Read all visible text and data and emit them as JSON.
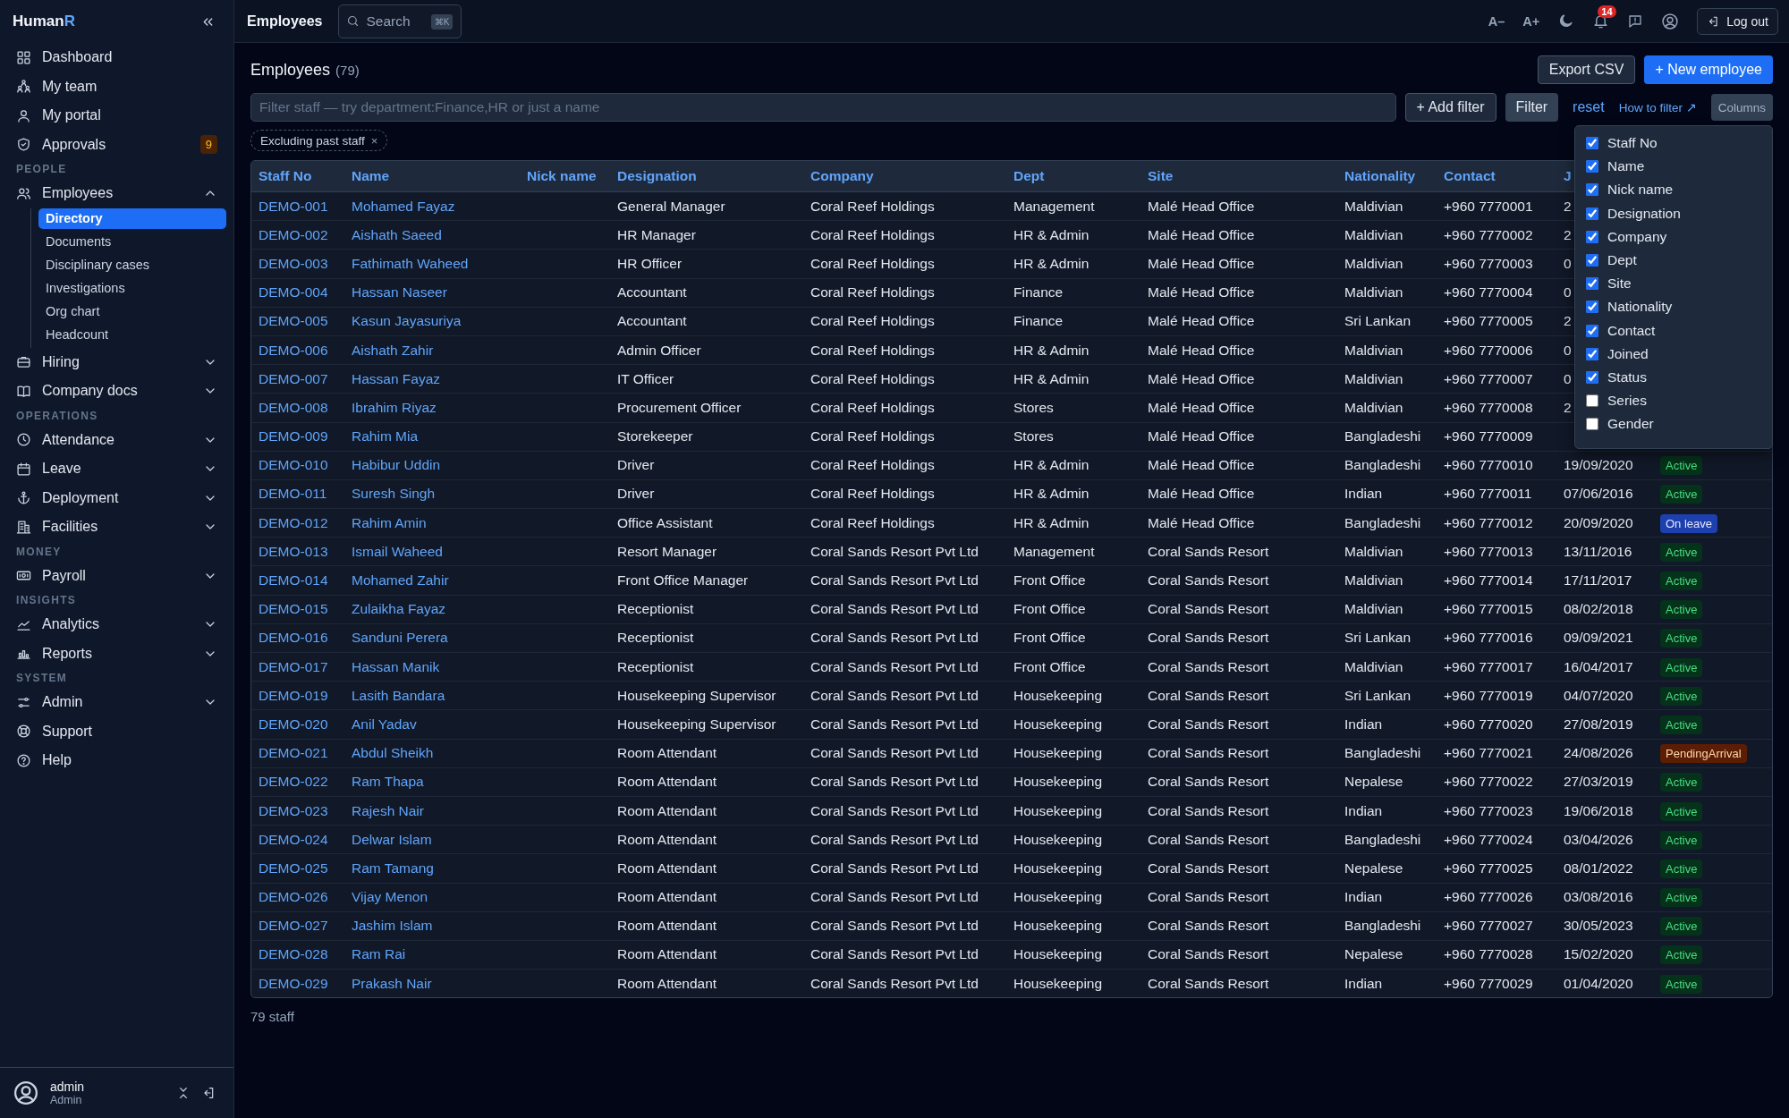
{
  "sidebar": {
    "brand": {
      "name": "Human",
      "accent": "R"
    },
    "groups": [
      {
        "items": [
          {
            "label": "Dashboard",
            "selected": false
          },
          {
            "label": "My team",
            "selected": false
          },
          {
            "label": "My portal",
            "selected": false
          },
          {
            "label": "Approvals",
            "badge": "9",
            "selected": false
          }
        ]
      },
      {
        "heading": "PEOPLE",
        "items": [
          {
            "label": "Employees",
            "selected": false,
            "expanded": true,
            "children": [
              {
                "label": "Directory",
                "selected": true
              },
              {
                "label": "Documents",
                "selected": false
              },
              {
                "label": "Disciplinary cases",
                "selected": false
              },
              {
                "label": "Investigations",
                "selected": false
              },
              {
                "label": "Org chart",
                "selected": false
              },
              {
                "label": "Headcount",
                "selected": false
              }
            ]
          },
          {
            "label": "Hiring",
            "selected": false,
            "expanded": false
          },
          {
            "label": "Company docs",
            "selected": false,
            "expanded": false
          }
        ]
      },
      {
        "heading": "OPERATIONS",
        "items": [
          {
            "label": "Attendance",
            "selected": false,
            "expanded": false
          },
          {
            "label": "Leave",
            "selected": false,
            "expanded": false
          },
          {
            "label": "Deployment",
            "selected": false,
            "expanded": false
          },
          {
            "label": "Facilities",
            "selected": false,
            "expanded": false
          }
        ]
      },
      {
        "heading": "MONEY",
        "items": [
          {
            "label": "Payroll",
            "selected": false,
            "expanded": false
          }
        ]
      },
      {
        "heading": "INSIGHTS",
        "items": [
          {
            "label": "Analytics",
            "selected": false,
            "expanded": false
          },
          {
            "label": "Reports",
            "selected": false,
            "expanded": false
          }
        ]
      },
      {
        "heading": "SYSTEM",
        "items": [
          {
            "label": "Admin",
            "selected": false,
            "expanded": false
          },
          {
            "label": "Support",
            "selected": false
          },
          {
            "label": "Help",
            "selected": false
          }
        ]
      }
    ],
    "user": {
      "name": "admin",
      "role": "Admin"
    }
  },
  "topbar": {
    "title": "Employees",
    "search": {
      "placeholder": "Search",
      "shortcut": "⌘K"
    },
    "font_smaller": "A–",
    "font_larger": "A+",
    "notifications": "14",
    "logout": "Log out"
  },
  "page": {
    "title": "Employees",
    "count": "(79)",
    "export": "Export CSV",
    "new_employee": "+ New employee",
    "filter": {
      "placeholder": "Filter staff — try department:Finance,HR or just a name"
    },
    "add_filter": "+ Add filter",
    "filter_button": "Filter",
    "reset": "reset",
    "help_link": "How to filter ↗",
    "columns_button": "Columns",
    "chips": [
      {
        "label": "Excluding past staff",
        "remove": "×"
      }
    ]
  },
  "table": {
    "columns": [
      "Staff No",
      "Name",
      "Nick name",
      "Designation",
      "Company",
      "Dept",
      "Site",
      "Nationality",
      "Contact",
      "J"
    ],
    "rows": [
      {
        "staff_no": "DEMO-001",
        "name": "Mohamed Fayaz",
        "designation": "General Manager",
        "company": "Coral Reef Holdings",
        "dept": "Management",
        "site": "Malé Head Office",
        "nationality": "Maldivian",
        "contact": "+960 7770001",
        "joined": "2"
      },
      {
        "staff_no": "DEMO-002",
        "name": "Aishath Saeed",
        "designation": "HR Manager",
        "company": "Coral Reef Holdings",
        "dept": "HR & Admin",
        "site": "Malé Head Office",
        "nationality": "Maldivian",
        "contact": "+960 7770002",
        "joined": "2"
      },
      {
        "staff_no": "DEMO-003",
        "name": "Fathimath Waheed",
        "designation": "HR Officer",
        "company": "Coral Reef Holdings",
        "dept": "HR & Admin",
        "site": "Malé Head Office",
        "nationality": "Maldivian",
        "contact": "+960 7770003",
        "joined": "0"
      },
      {
        "staff_no": "DEMO-004",
        "name": "Hassan Naseer",
        "designation": "Accountant",
        "company": "Coral Reef Holdings",
        "dept": "Finance",
        "site": "Malé Head Office",
        "nationality": "Maldivian",
        "contact": "+960 7770004",
        "joined": "0"
      },
      {
        "staff_no": "DEMO-005",
        "name": "Kasun Jayasuriya",
        "designation": "Accountant",
        "company": "Coral Reef Holdings",
        "dept": "Finance",
        "site": "Malé Head Office",
        "nationality": "Sri Lankan",
        "contact": "+960 7770005",
        "joined": "2"
      },
      {
        "staff_no": "DEMO-006",
        "name": "Aishath Zahir",
        "designation": "Admin Officer",
        "company": "Coral Reef Holdings",
        "dept": "HR & Admin",
        "site": "Malé Head Office",
        "nationality": "Maldivian",
        "contact": "+960 7770006",
        "joined": "0"
      },
      {
        "staff_no": "DEMO-007",
        "name": "Hassan Fayaz",
        "designation": "IT Officer",
        "company": "Coral Reef Holdings",
        "dept": "HR & Admin",
        "site": "Malé Head Office",
        "nationality": "Maldivian",
        "contact": "+960 7770007",
        "joined": "0"
      },
      {
        "staff_no": "DEMO-008",
        "name": "Ibrahim Riyaz",
        "designation": "Procurement Officer",
        "company": "Coral Reef Holdings",
        "dept": "Stores",
        "site": "Malé Head Office",
        "nationality": "Maldivian",
        "contact": "+960 7770008",
        "joined": "2"
      },
      {
        "staff_no": "DEMO-009",
        "name": "Rahim Mia",
        "designation": "Storekeeper",
        "company": "Coral Reef Holdings",
        "dept": "Stores",
        "site": "Malé Head Office",
        "nationality": "Bangladeshi",
        "contact": "+960 7770009"
      },
      {
        "staff_no": "DEMO-010",
        "name": "Habibur Uddin",
        "designation": "Driver",
        "company": "Coral Reef Holdings",
        "dept": "HR & Admin",
        "site": "Malé Head Office",
        "nationality": "Bangladeshi",
        "contact": "+960 7770010",
        "joined": "19/09/2020",
        "status": {
          "label": "Active",
          "kind": "active"
        }
      },
      {
        "staff_no": "DEMO-011",
        "name": "Suresh Singh",
        "designation": "Driver",
        "company": "Coral Reef Holdings",
        "dept": "HR & Admin",
        "site": "Malé Head Office",
        "nationality": "Indian",
        "contact": "+960 7770011",
        "joined": "07/06/2016",
        "status": {
          "label": "Active",
          "kind": "active"
        }
      },
      {
        "staff_no": "DEMO-012",
        "name": "Rahim Amin",
        "designation": "Office Assistant",
        "company": "Coral Reef Holdings",
        "dept": "HR & Admin",
        "site": "Malé Head Office",
        "nationality": "Bangladeshi",
        "contact": "+960 7770012",
        "joined": "20/09/2020",
        "status": {
          "label": "On leave",
          "kind": "leave"
        }
      },
      {
        "staff_no": "DEMO-013",
        "name": "Ismail Waheed",
        "designation": "Resort Manager",
        "company": "Coral Sands Resort Pvt Ltd",
        "dept": "Management",
        "site": "Coral Sands Resort",
        "nationality": "Maldivian",
        "contact": "+960 7770013",
        "joined": "13/11/2016",
        "status": {
          "label": "Active",
          "kind": "active"
        }
      },
      {
        "staff_no": "DEMO-014",
        "name": "Mohamed Zahir",
        "designation": "Front Office Manager",
        "company": "Coral Sands Resort Pvt Ltd",
        "dept": "Front Office",
        "site": "Coral Sands Resort",
        "nationality": "Maldivian",
        "contact": "+960 7770014",
        "joined": "17/11/2017",
        "status": {
          "label": "Active",
          "kind": "active"
        }
      },
      {
        "staff_no": "DEMO-015",
        "name": "Zulaikha Fayaz",
        "designation": "Receptionist",
        "company": "Coral Sands Resort Pvt Ltd",
        "dept": "Front Office",
        "site": "Coral Sands Resort",
        "nationality": "Maldivian",
        "contact": "+960 7770015",
        "joined": "08/02/2018",
        "status": {
          "label": "Active",
          "kind": "active"
        }
      },
      {
        "staff_no": "DEMO-016",
        "name": "Sanduni Perera",
        "designation": "Receptionist",
        "company": "Coral Sands Resort Pvt Ltd",
        "dept": "Front Office",
        "site": "Coral Sands Resort",
        "nationality": "Sri Lankan",
        "contact": "+960 7770016",
        "joined": "09/09/2021",
        "status": {
          "label": "Active",
          "kind": "active"
        }
      },
      {
        "staff_no": "DEMO-017",
        "name": "Hassan Manik",
        "designation": "Receptionist",
        "company": "Coral Sands Resort Pvt Ltd",
        "dept": "Front Office",
        "site": "Coral Sands Resort",
        "nationality": "Maldivian",
        "contact": "+960 7770017",
        "joined": "16/04/2017",
        "status": {
          "label": "Active",
          "kind": "active"
        }
      },
      {
        "staff_no": "DEMO-019",
        "name": "Lasith Bandara",
        "designation": "Housekeeping Supervisor",
        "company": "Coral Sands Resort Pvt Ltd",
        "dept": "Housekeeping",
        "site": "Coral Sands Resort",
        "nationality": "Sri Lankan",
        "contact": "+960 7770019",
        "joined": "04/07/2020",
        "status": {
          "label": "Active",
          "kind": "active"
        }
      },
      {
        "staff_no": "DEMO-020",
        "name": "Anil Yadav",
        "designation": "Housekeeping Supervisor",
        "company": "Coral Sands Resort Pvt Ltd",
        "dept": "Housekeeping",
        "site": "Coral Sands Resort",
        "nationality": "Indian",
        "contact": "+960 7770020",
        "joined": "27/08/2019",
        "status": {
          "label": "Active",
          "kind": "active"
        }
      },
      {
        "staff_no": "DEMO-021",
        "name": "Abdul Sheikh",
        "designation": "Room Attendant",
        "company": "Coral Sands Resort Pvt Ltd",
        "dept": "Housekeeping",
        "site": "Coral Sands Resort",
        "nationality": "Bangladeshi",
        "contact": "+960 7770021",
        "joined": "24/08/2026",
        "status": {
          "label": "PendingArrival",
          "kind": "pending"
        }
      },
      {
        "staff_no": "DEMO-022",
        "name": "Ram Thapa",
        "designation": "Room Attendant",
        "company": "Coral Sands Resort Pvt Ltd",
        "dept": "Housekeeping",
        "site": "Coral Sands Resort",
        "nationality": "Nepalese",
        "contact": "+960 7770022",
        "joined": "27/03/2019",
        "status": {
          "label": "Active",
          "kind": "active"
        }
      },
      {
        "staff_no": "DEMO-023",
        "name": "Rajesh Nair",
        "designation": "Room Attendant",
        "company": "Coral Sands Resort Pvt Ltd",
        "dept": "Housekeeping",
        "site": "Coral Sands Resort",
        "nationality": "Indian",
        "contact": "+960 7770023",
        "joined": "19/06/2018",
        "status": {
          "label": "Active",
          "kind": "active"
        }
      },
      {
        "staff_no": "DEMO-024",
        "name": "Delwar Islam",
        "designation": "Room Attendant",
        "company": "Coral Sands Resort Pvt Ltd",
        "dept": "Housekeeping",
        "site": "Coral Sands Resort",
        "nationality": "Bangladeshi",
        "contact": "+960 7770024",
        "joined": "03/04/2026",
        "status": {
          "label": "Active",
          "kind": "active"
        }
      },
      {
        "staff_no": "DEMO-025",
        "name": "Ram Tamang",
        "designation": "Room Attendant",
        "company": "Coral Sands Resort Pvt Ltd",
        "dept": "Housekeeping",
        "site": "Coral Sands Resort",
        "nationality": "Nepalese",
        "contact": "+960 7770025",
        "joined": "08/01/2022",
        "status": {
          "label": "Active",
          "kind": "active"
        }
      },
      {
        "staff_no": "DEMO-026",
        "name": "Vijay Menon",
        "designation": "Room Attendant",
        "company": "Coral Sands Resort Pvt Ltd",
        "dept": "Housekeeping",
        "site": "Coral Sands Resort",
        "nationality": "Indian",
        "contact": "+960 7770026",
        "joined": "03/08/2016",
        "status": {
          "label": "Active",
          "kind": "active"
        }
      },
      {
        "staff_no": "DEMO-027",
        "name": "Jashim Islam",
        "designation": "Room Attendant",
        "company": "Coral Sands Resort Pvt Ltd",
        "dept": "Housekeeping",
        "site": "Coral Sands Resort",
        "nationality": "Bangladeshi",
        "contact": "+960 7770027",
        "joined": "30/05/2023",
        "status": {
          "label": "Active",
          "kind": "active"
        }
      },
      {
        "staff_no": "DEMO-028",
        "name": "Ram Rai",
        "designation": "Room Attendant",
        "company": "Coral Sands Resort Pvt Ltd",
        "dept": "Housekeeping",
        "site": "Coral Sands Resort",
        "nationality": "Nepalese",
        "contact": "+960 7770028",
        "joined": "15/02/2020",
        "status": {
          "label": "Active",
          "kind": "active"
        }
      },
      {
        "staff_no": "DEMO-029",
        "name": "Prakash Nair",
        "designation": "Room Attendant",
        "company": "Coral Sands Resort Pvt Ltd",
        "dept": "Housekeeping",
        "site": "Coral Sands Resort",
        "nationality": "Indian",
        "contact": "+960 7770029",
        "joined": "01/04/2020",
        "status": {
          "label": "Active",
          "kind": "active"
        }
      }
    ]
  },
  "column_menu": {
    "items": [
      {
        "label": "Staff No",
        "checked": true
      },
      {
        "label": "Name",
        "checked": true
      },
      {
        "label": "Nick name",
        "checked": true
      },
      {
        "label": "Designation",
        "checked": true
      },
      {
        "label": "Company",
        "checked": true
      },
      {
        "label": "Dept",
        "checked": true
      },
      {
        "label": "Site",
        "checked": true
      },
      {
        "label": "Nationality",
        "checked": true
      },
      {
        "label": "Contact",
        "checked": true
      },
      {
        "label": "Joined",
        "checked": true
      },
      {
        "label": "Status",
        "checked": true
      },
      {
        "label": "Series",
        "checked": false
      },
      {
        "label": "Gender",
        "checked": false
      }
    ]
  },
  "footer": "79 staff"
}
